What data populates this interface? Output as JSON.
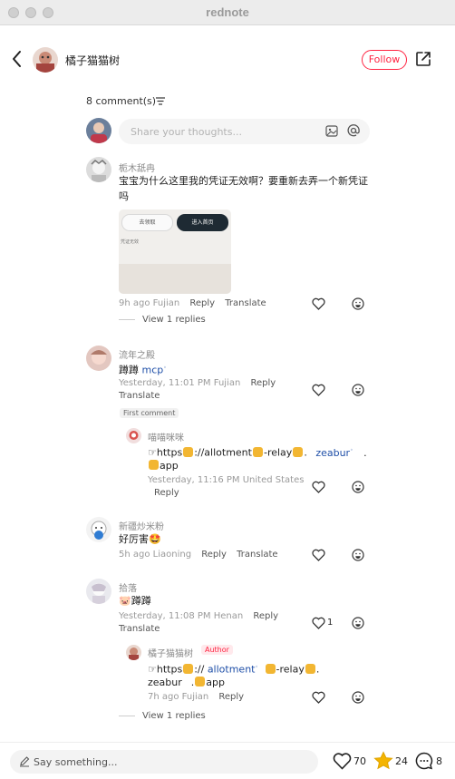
{
  "window": {
    "title": "rednote"
  },
  "header": {
    "author_name": "橘子猫猫树",
    "follow_label": "Follow"
  },
  "comments_header": {
    "count_label": "8 comment(s)"
  },
  "input": {
    "placeholder": "Share your thoughts..."
  },
  "comments": [
    {
      "name": "栀木舐冉",
      "text_line1": "宝宝为什么这里我的凭证无效啊？要重新去弄一个新凭证",
      "text_line2": "吗",
      "image": {
        "button_left": "去领取",
        "button_right": "进入首页",
        "caption": "凭证无效"
      },
      "time": "9h ago Fujian",
      "reply": "Reply",
      "translate": "Translate",
      "view_replies": "View 1 replies"
    },
    {
      "name": "流年之殿",
      "text": "蹲蹲",
      "link": "mcp",
      "time": "Yesterday, 11:01 PM Fujian",
      "reply": "Reply",
      "translate": "Translate",
      "badge": "First comment",
      "reply_item": {
        "name": "喵喵咪咪",
        "line1_a": "☞https",
        "line1_b": "://allotment",
        "line1_c": "-relay",
        "line1_d": ".",
        "line1_link": "zeabur",
        "line1_e": ".",
        "line2": "app",
        "time": "Yesterday, 11:16 PM United States",
        "reply": "Reply"
      }
    },
    {
      "name": "新疆炒米粉",
      "text": "好厉害🤩",
      "time": "5h ago Liaoning",
      "reply": "Reply",
      "translate": "Translate"
    },
    {
      "name": "拾落",
      "text": "🐷蹲蹲",
      "time": "Yesterday, 11:08 PM Henan",
      "reply": "Reply",
      "translate": "Translate",
      "likes": "1",
      "reply_item": {
        "name": "橘子猫猫树",
        "badge": "Author",
        "line1_a": "☞https",
        "line1_b": "://",
        "line1_link": "allotment",
        "line1_c": "-relay",
        "line1_d": ".",
        "line2_a": "zeabur",
        "line2_b": ".",
        "line2_c": "app",
        "time": "7h ago Fujian",
        "reply": "Reply",
        "view_replies": "View 1 replies"
      }
    }
  ],
  "bottom": {
    "placeholder": "Say something...",
    "likes": "70",
    "stars": "24",
    "comments": "8"
  },
  "colors": {
    "accent": "#ff2442",
    "link": "#1f4fa8",
    "star": "#f4b400"
  }
}
